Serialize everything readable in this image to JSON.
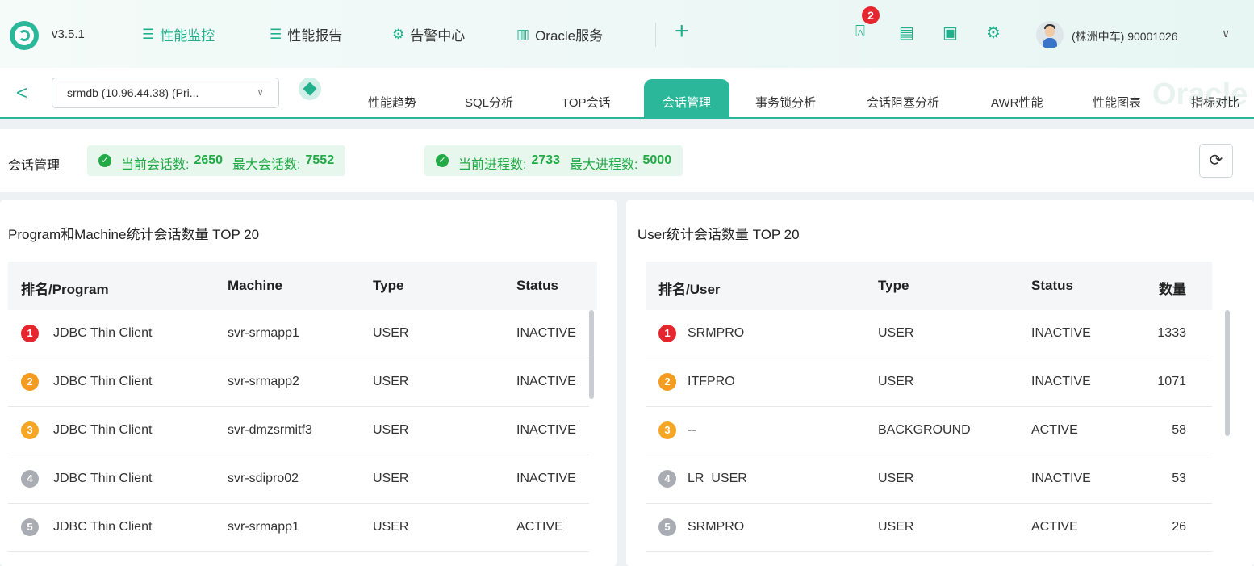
{
  "header": {
    "version": "v3.5.1",
    "nav": [
      {
        "label": "性能监控",
        "icon": "monitor-icon",
        "active": true
      },
      {
        "label": "性能报告",
        "icon": "report-icon",
        "active": false
      },
      {
        "label": "告警中心",
        "icon": "alarm-icon",
        "active": false
      },
      {
        "label": "Oracle服务",
        "icon": "chart-bars-icon",
        "active": false
      }
    ],
    "add_label": "+",
    "notification_count": "2",
    "user": "(株洲中车) 90001026",
    "user_chevron": "∨"
  },
  "subnav": {
    "back": "<",
    "db_select": "srmdb (10.96.44.38) (Pri...",
    "db_select_chevron": "∨",
    "tabs": [
      "性能趋势",
      "SQL分析",
      "TOP会话",
      "会话管理",
      "事务锁分析",
      "会话阻塞分析",
      "AWR性能",
      "性能图表",
      "指标对比"
    ],
    "active_tab": "会话管理",
    "watermark": "Oracle"
  },
  "summary": {
    "title": "会话管理",
    "sessions": {
      "current_label": "当前会话数:",
      "current": "2650",
      "max_label": "最大会话数:",
      "max": "7552"
    },
    "processes": {
      "current_label": "当前进程数:",
      "current": "2733",
      "max_label": "最大进程数:",
      "max": "5000"
    },
    "refresh": "⟳"
  },
  "left_panel": {
    "title": "Program和Machine统计会话数量 TOP 20",
    "columns": [
      "排名/Program",
      "Machine",
      "Type",
      "Status"
    ],
    "rows": [
      {
        "rank": "1",
        "program": "JDBC Thin Client",
        "machine": "svr-srmapp1",
        "type": "USER",
        "status": "INACTIVE"
      },
      {
        "rank": "2",
        "program": "JDBC Thin Client",
        "machine": "svr-srmapp2",
        "type": "USER",
        "status": "INACTIVE"
      },
      {
        "rank": "3",
        "program": "JDBC Thin Client",
        "machine": "svr-dmzsrmitf3",
        "type": "USER",
        "status": "INACTIVE"
      },
      {
        "rank": "4",
        "program": "JDBC Thin Client",
        "machine": "svr-sdipro02",
        "type": "USER",
        "status": "INACTIVE"
      },
      {
        "rank": "5",
        "program": "JDBC Thin Client",
        "machine": "svr-srmapp1",
        "type": "USER",
        "status": "ACTIVE"
      }
    ]
  },
  "right_panel": {
    "title": "User统计会话数量 TOP 20",
    "columns": [
      "排名/User",
      "Type",
      "Status",
      "数量"
    ],
    "rows": [
      {
        "rank": "1",
        "user": "SRMPRO",
        "type": "USER",
        "status": "INACTIVE",
        "count": "1333"
      },
      {
        "rank": "2",
        "user": "ITFPRO",
        "type": "USER",
        "status": "INACTIVE",
        "count": "1071"
      },
      {
        "rank": "3",
        "user": "--",
        "type": "BACKGROUND",
        "status": "ACTIVE",
        "count": "58"
      },
      {
        "rank": "4",
        "user": "LR_USER",
        "type": "USER",
        "status": "INACTIVE",
        "count": "53"
      },
      {
        "rank": "5",
        "user": "SRMPRO",
        "type": "USER",
        "status": "ACTIVE",
        "count": "26"
      }
    ]
  },
  "rank_colors": {
    "1": "#e5262f",
    "2": "#f39c1f",
    "3": "#f5a623",
    "4": "#a9adb3",
    "5": "#a9adb3"
  },
  "accent_color": "#2bb89a"
}
